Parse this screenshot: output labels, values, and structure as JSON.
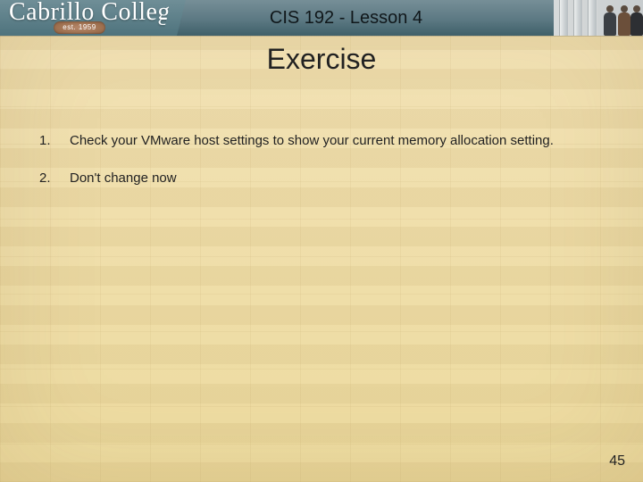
{
  "header": {
    "logo_text": "Cabrillo College",
    "logo_subtext": "est. 1959",
    "title": "CIS 192 - Lesson 4"
  },
  "slide": {
    "title": "Exercise",
    "items": [
      {
        "num": "1.",
        "text": "Check your VMware host settings to show your current memory allocation setting."
      },
      {
        "num": "2.",
        "text": "Don't change now"
      }
    ],
    "page_number": "45"
  }
}
